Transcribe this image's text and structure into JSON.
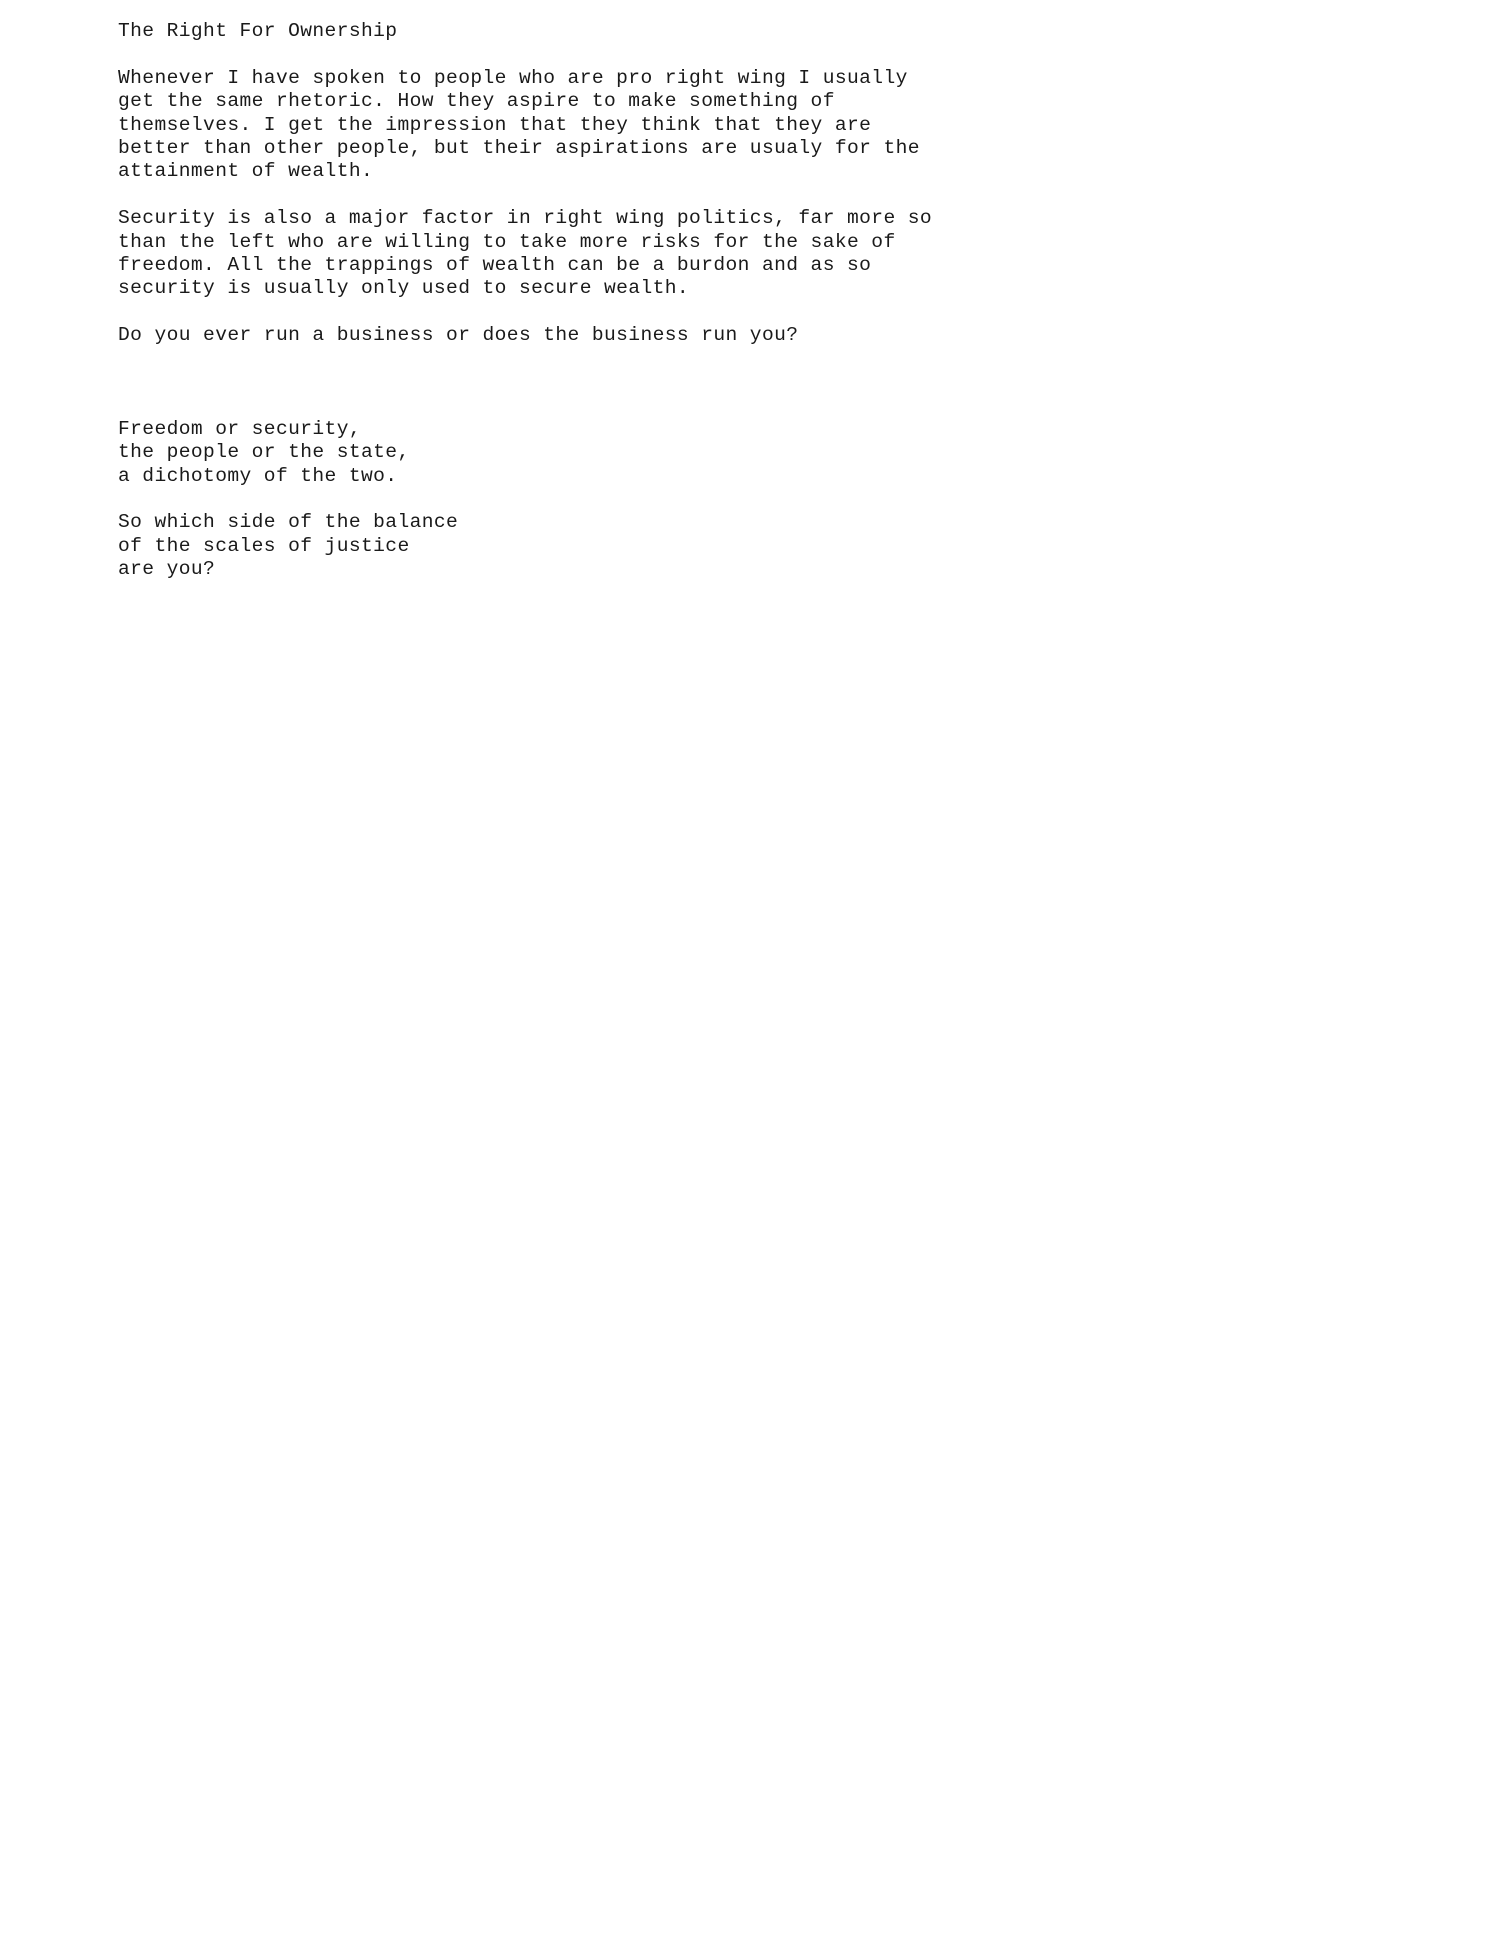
{
  "document": {
    "title": "The Right For Ownership",
    "background_color": "#ffffff",
    "text_color": "#1a1a1a",
    "blocks": [
      {
        "id": "title",
        "type": "heading",
        "lines": [
          "The Right For Ownership"
        ]
      },
      {
        "id": "paragraph-1",
        "type": "paragraph",
        "lines": [
          "Whenever I have spoken to people who are pro right wing I usually",
          "get the same rhetoric. How they aspire to make something of",
          "themselves. I get the impression that they think that they are",
          "better than other people, but their aspirations are usualy for the",
          "attainment of wealth."
        ]
      },
      {
        "id": "paragraph-2",
        "type": "paragraph",
        "lines": [
          "Security is also a major factor in right wing politics, far more so",
          "than the left who are willing to take more risks for the sake of",
          "freedom. All the trappings of wealth can be a burdon and as so",
          "security is usually only used to secure wealth."
        ]
      },
      {
        "id": "paragraph-3",
        "type": "paragraph",
        "lines": [
          "Do you ever run a business or does the business run you?"
        ]
      },
      {
        "id": "stanza-1",
        "type": "verse",
        "lines": [
          "Freedom or security,",
          "the people or the state,",
          "a dichotomy of the two."
        ]
      },
      {
        "id": "stanza-2",
        "type": "verse",
        "lines": [
          "So which side of the balance",
          "of the scales of justice",
          "are you?"
        ]
      }
    ]
  }
}
